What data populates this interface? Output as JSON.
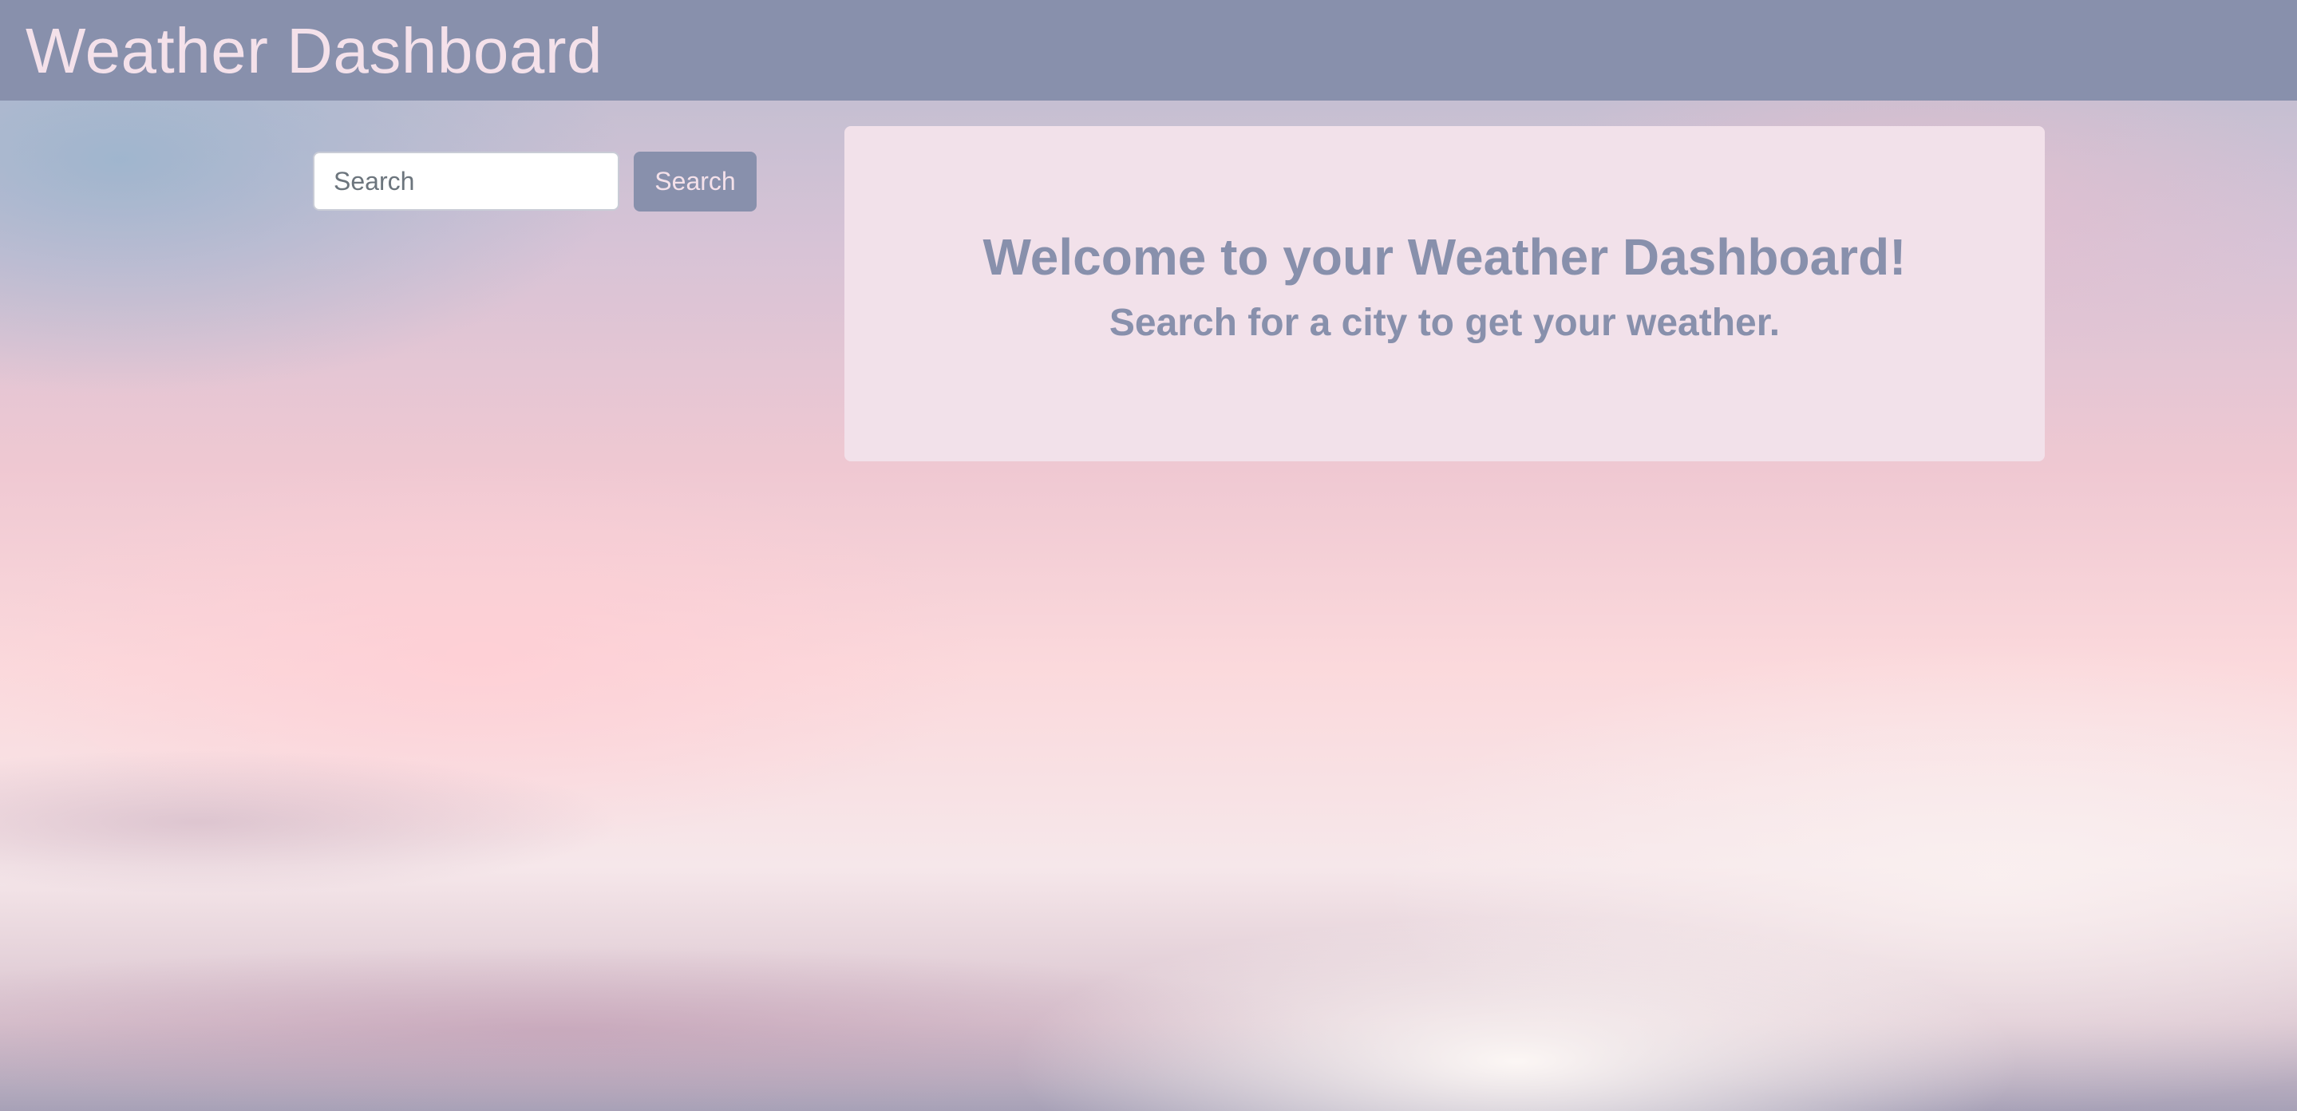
{
  "header": {
    "title": "Weather Dashboard"
  },
  "search": {
    "placeholder": "Search",
    "button_label": "Search"
  },
  "welcome": {
    "heading": "Welcome to your Weather Dashboard!",
    "subheading": "Search for a city to get your weather."
  },
  "colors": {
    "header_bg": "#8890ac",
    "header_text": "#f4e1ea",
    "card_bg": "#f2e1ea",
    "accent": "#8890ac"
  }
}
